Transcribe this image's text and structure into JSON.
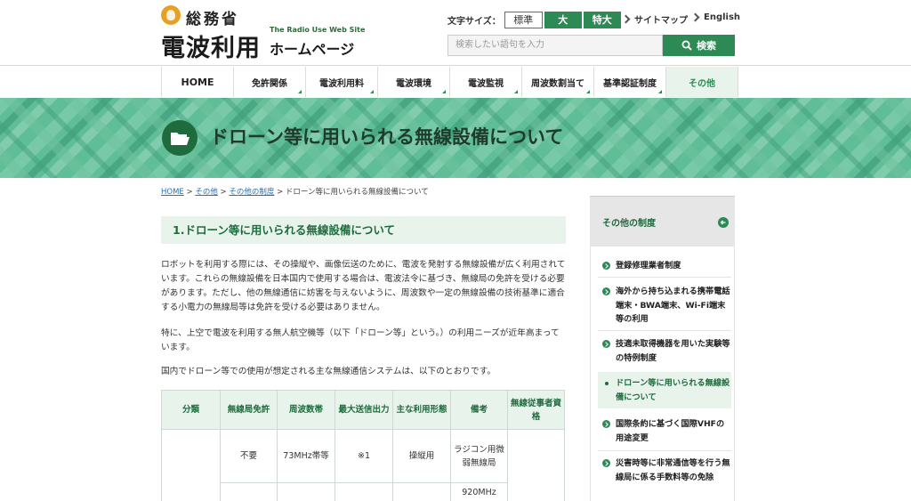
{
  "header": {
    "org_name": "総務省",
    "site_name_main": "電波利用",
    "site_name_sub": "The Radio Use Web Site",
    "site_name_home": "ホームページ",
    "font_size_label": "文字サイズ：",
    "font_size_options": [
      "標準",
      "大",
      "特大"
    ],
    "sitemap_label": "サイトマップ",
    "english_label": "English",
    "search_placeholder": "検索したい語句を入力",
    "search_button": "検索"
  },
  "nav": {
    "items": [
      "HOME",
      "免許関係",
      "電波利用料",
      "電波環境",
      "電波監視",
      "周波数割当て",
      "基準認証制度",
      "その他"
    ],
    "active": "その他"
  },
  "banner": {
    "title": "ドローン等に用いられる無線設備について"
  },
  "breadcrumb": {
    "items": [
      "HOME",
      "その他",
      "その他の制度"
    ],
    "separator": ">",
    "current": "ドローン等に用いられる無線設備について"
  },
  "main": {
    "section_heading": "1.ドローン等に用いられる無線設備について",
    "para1": "ロボットを利用する際には、その操縦や、画像伝送のために、電波を発射する無線設備が広く利用されています。これらの無線設備を日本国内で使用する場合は、電波法令に基づき、無線局の免許を受ける必要があります。ただし、他の無線通信に妨害を与えないように、周波数や一定の無線設備の技術基準に適合する小電力の無線局等は免許を受ける必要はありません。",
    "para2": "特に、上空で電波を利用する無人航空機等（以下「ドローン等」という。）の利用ニーズが近年高まっています。",
    "para3": "国内でドローン等での使用が想定される主な無線通信システムは、以下のとおりです。",
    "table": {
      "headers": [
        "分類",
        "無線局免許",
        "周波数帯",
        "最大送信出力",
        "主な利用形態",
        "備考",
        "無線従事者資格"
      ],
      "rows": [
        [
          "",
          "不要",
          "73MHz帯等",
          "※1",
          "操縦用",
          "ラジコン用微弱無線局",
          ""
        ],
        [
          "",
          "",
          "",
          "",
          "",
          "920MHz",
          ""
        ]
      ]
    }
  },
  "sidebar": {
    "heading": "その他の制度",
    "items": [
      "登録修理業者制度",
      "海外から持ち込まれる携帯電話端末・BWA端末、Wi-Fi端末等の利用",
      "技適未取得機器を用いた実験等の特例制度",
      "ドローン等に用いられる無線設備について",
      "国際条約に基づく国際VHFの用途変更",
      "災害時等に非常通信等を行う無線局に係る手数料等の免除"
    ],
    "active_index": 3
  },
  "colors": {
    "brand_green": "#2d8a55",
    "light_green": "#e8f3ec",
    "banner_green": "#5fbd97",
    "logo_orange": "#e8a024"
  }
}
